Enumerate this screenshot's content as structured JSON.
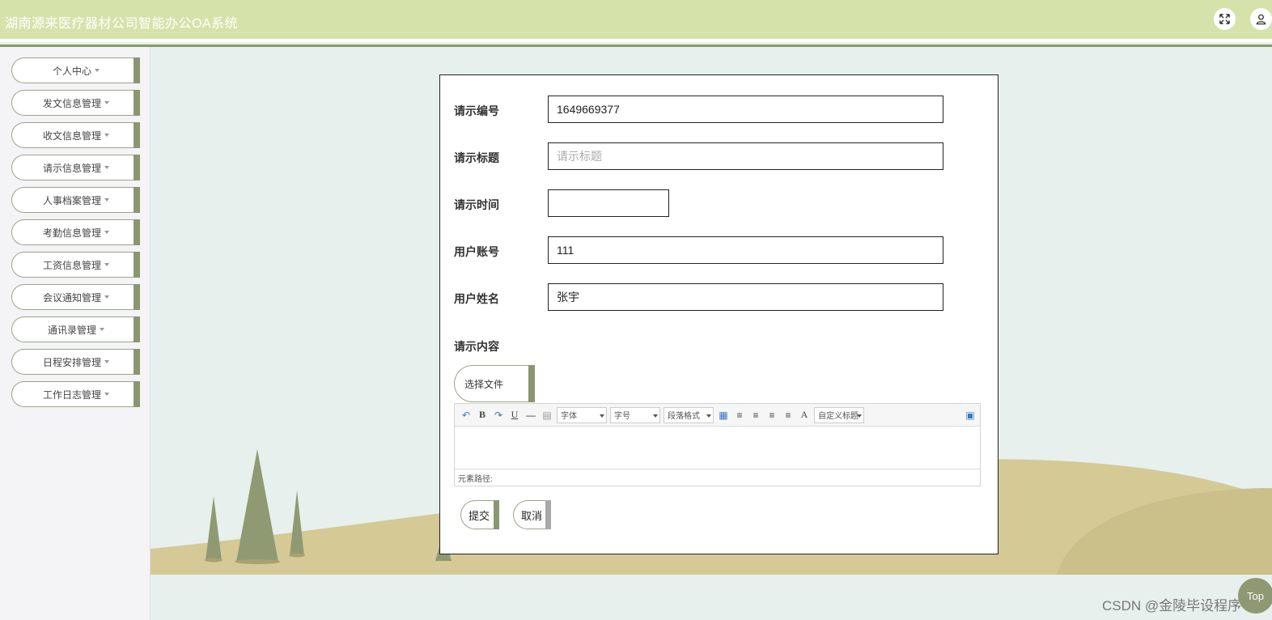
{
  "header": {
    "title": "湖南源来医疗器材公司智能办公OA系统"
  },
  "sidebar": {
    "items": [
      {
        "label": "个人中心"
      },
      {
        "label": "发文信息管理"
      },
      {
        "label": "收文信息管理"
      },
      {
        "label": "请示信息管理"
      },
      {
        "label": "人事档案管理"
      },
      {
        "label": "考勤信息管理"
      },
      {
        "label": "工资信息管理"
      },
      {
        "label": "会议通知管理"
      },
      {
        "label": "通讯录管理"
      },
      {
        "label": "日程安排管理"
      },
      {
        "label": "工作日志管理"
      }
    ]
  },
  "form": {
    "request_no": {
      "label": "请示编号",
      "value": "1649669377"
    },
    "request_title": {
      "label": "请示标题",
      "placeholder": "请示标题"
    },
    "request_time": {
      "label": "请示时间",
      "value": ""
    },
    "user_account": {
      "label": "用户账号",
      "value": "111"
    },
    "user_name": {
      "label": "用户姓名",
      "value": "张宇"
    },
    "request_content": {
      "label": "请示内容"
    },
    "file_button": "选择文件",
    "editor": {
      "font_select": "字体",
      "size_select": "字号",
      "paragraph_select": "段落格式",
      "custom_title_select": "自定义标题",
      "status_path": "元素路径:"
    },
    "submit_label": "提交",
    "cancel_label": "取消"
  },
  "watermark": "CSDN @金陵毕设程序",
  "top_button": "Top"
}
